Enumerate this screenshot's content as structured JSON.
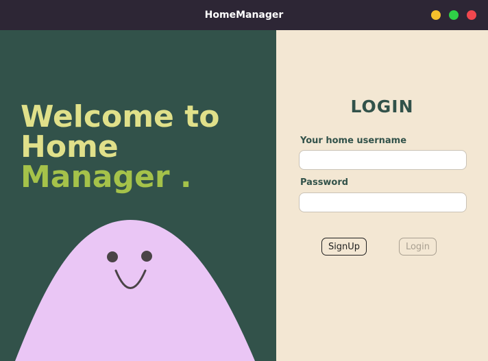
{
  "window": {
    "title": "HomeManager",
    "controls": [
      {
        "name": "minimize",
        "color": "#f5bf2c"
      },
      {
        "name": "maximize",
        "color": "#2fd047"
      },
      {
        "name": "close",
        "color": "#f0474e"
      }
    ]
  },
  "welcome": {
    "line1": "Welcome to",
    "line2": "Home",
    "line3": "Manager ."
  },
  "login": {
    "title": "LOGIN",
    "username_label": "Your home username",
    "username_value": "",
    "password_label": "Password",
    "password_value": "",
    "signup_label": "SignUp",
    "login_label": "Login"
  },
  "colors": {
    "left_bg": "#32524a",
    "right_bg": "#f3e7d3",
    "blob": "#eac6f5",
    "accent_yellow": "#e0e08a",
    "accent_green": "#a5c24a"
  }
}
